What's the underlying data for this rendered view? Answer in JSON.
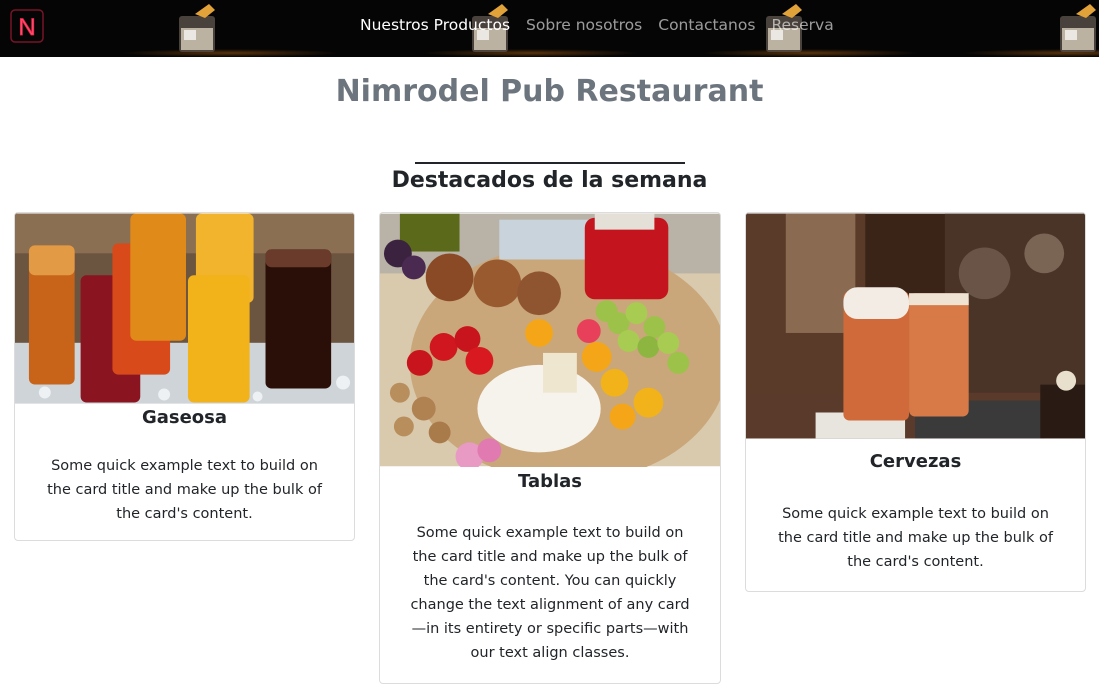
{
  "nav": {
    "brand_letter": "N",
    "links": [
      "Nuestros Productos",
      "Sobre nosotros",
      "Contactanos",
      "Reserva"
    ]
  },
  "header": {
    "title": "Nimrodel Pub Restaurant"
  },
  "section": {
    "title": "Destacados de la semana"
  },
  "cards": [
    {
      "title": "Gaseosa",
      "text": "Some quick example text to build on the card title and make up the bulk of the card's content.",
      "image": "soft-drinks-photo"
    },
    {
      "title": "Tablas",
      "text": "Some quick example text to build on the card title and make up the bulk of the card's content. You can quickly change the text alignment of any card—in its entirety or specific parts—with our text align classes.",
      "image": "cheese-board-photo"
    },
    {
      "title": "Cervezas",
      "text": "Some quick example text to build on the card title and make up the bulk of the card's content.",
      "image": "beer-glasses-photo"
    }
  ],
  "colors": {
    "navbar_bg": "#050505",
    "brand_neon": "#e8264b",
    "title_gray": "#6c757d"
  }
}
